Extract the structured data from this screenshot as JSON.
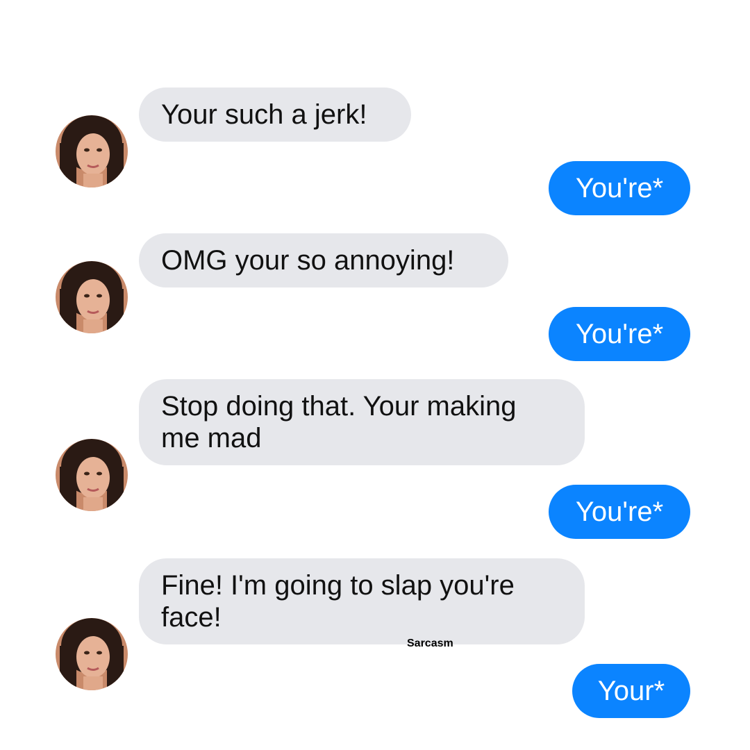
{
  "conversation": {
    "messages": [
      {
        "sender": "contact",
        "text": "Your such a jerk!"
      },
      {
        "sender": "me",
        "text": "You're*"
      },
      {
        "sender": "contact",
        "text": "OMG your so annoying!"
      },
      {
        "sender": "me",
        "text": "You're*"
      },
      {
        "sender": "contact",
        "text": "Stop doing that. Your making me mad"
      },
      {
        "sender": "me",
        "text": "You're*"
      },
      {
        "sender": "contact",
        "text": "Fine! I'm going to slap you're face!"
      },
      {
        "sender": "me",
        "text": "Your*"
      }
    ]
  },
  "watermark": "Sarcasm",
  "colors": {
    "incoming_bubble": "#e6e7eb",
    "outgoing_bubble": "#0b84ff",
    "incoming_text": "#111111",
    "outgoing_text": "#ffffff"
  }
}
